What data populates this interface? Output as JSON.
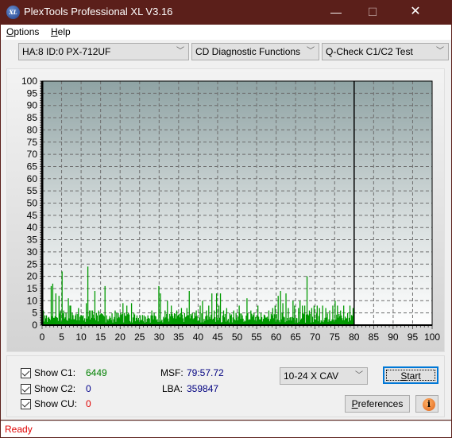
{
  "window": {
    "title": "PlexTools Professional XL V3.16",
    "icon_label": "XL",
    "minimize_glyph": "—",
    "maximize_glyph": "☐",
    "close_glyph": "✕"
  },
  "menu": {
    "items": [
      {
        "label": "Options",
        "accel": "O",
        "rest": "ptions"
      },
      {
        "label": "Help",
        "accel": "H",
        "rest": "elp"
      }
    ]
  },
  "toolbar": {
    "drive_select": "HA:8 ID:0  PX-712UF",
    "function_select": "CD Diagnostic Functions",
    "test_select": "Q-Check C1/C2 Test",
    "chevron_glyph": "﹀"
  },
  "colors": {
    "c1": "#009900",
    "c2": "#0000cc",
    "cu": "#e00000",
    "titlebar": "#5b1f1a",
    "status_text": "#e00000"
  },
  "chart_data": {
    "type": "bar",
    "title": "",
    "xlabel": "",
    "ylabel": "",
    "xlim": [
      0,
      100
    ],
    "ylim": [
      0,
      100
    ],
    "xticks": [
      0,
      5,
      10,
      15,
      20,
      25,
      30,
      35,
      40,
      45,
      50,
      55,
      60,
      65,
      70,
      75,
      80,
      85,
      90,
      95,
      100
    ],
    "yticks": [
      0,
      5,
      10,
      15,
      20,
      25,
      30,
      35,
      40,
      45,
      50,
      55,
      60,
      65,
      70,
      75,
      80,
      85,
      90,
      95,
      100
    ],
    "grid": true,
    "end_marker_x": 80,
    "series": [
      {
        "name": "C1",
        "color": "#009900",
        "x_step": 0.2,
        "x_start": 0,
        "peaks": [
          [
            0.2,
            6
          ],
          [
            0.6,
            4
          ],
          [
            1.0,
            4
          ],
          [
            1.4,
            3
          ],
          [
            2.2,
            16
          ],
          [
            2.6,
            17
          ],
          [
            3.0,
            3
          ],
          [
            3.4,
            13
          ],
          [
            3.8,
            3
          ],
          [
            4.2,
            12
          ],
          [
            4.6,
            6
          ],
          [
            4.9,
            22
          ],
          [
            5.1,
            22
          ],
          [
            5.4,
            6
          ],
          [
            6.0,
            5
          ],
          [
            6.6,
            11
          ],
          [
            7.0,
            8
          ],
          [
            7.2,
            8
          ],
          [
            7.6,
            5
          ],
          [
            8.4,
            4
          ],
          [
            9.2,
            7
          ],
          [
            9.8,
            4
          ],
          [
            10.4,
            4
          ],
          [
            11.2,
            9
          ],
          [
            11.5,
            24
          ],
          [
            11.9,
            6
          ],
          [
            12.4,
            6
          ],
          [
            12.8,
            6
          ],
          [
            13.3,
            14
          ],
          [
            13.8,
            5
          ],
          [
            14.4,
            6
          ],
          [
            16.0,
            16
          ],
          [
            16.4,
            4
          ],
          [
            17.4,
            3
          ],
          [
            18.6,
            6
          ],
          [
            19.4,
            5
          ],
          [
            20.0,
            5
          ],
          [
            20.5,
            9
          ],
          [
            21.0,
            5
          ],
          [
            21.5,
            8
          ],
          [
            22.0,
            5
          ],
          [
            22.8,
            9
          ],
          [
            23.4,
            5
          ],
          [
            24.2,
            4
          ],
          [
            25.0,
            4
          ],
          [
            26.0,
            4
          ],
          [
            27.0,
            4
          ],
          [
            28.0,
            6
          ],
          [
            28.6,
            5
          ],
          [
            29.7,
            16
          ],
          [
            30.2,
            13
          ],
          [
            31.4,
            6
          ],
          [
            32.0,
            10
          ],
          [
            33.0,
            8
          ],
          [
            34.4,
            6
          ],
          [
            35.6,
            7
          ],
          [
            37.0,
            7
          ],
          [
            37.6,
            14
          ],
          [
            38.4,
            5
          ],
          [
            39.4,
            6
          ],
          [
            40.4,
            8
          ],
          [
            41.0,
            10
          ],
          [
            42.0,
            6
          ],
          [
            42.6,
            8
          ],
          [
            43.4,
            13
          ],
          [
            44.0,
            6
          ],
          [
            44.5,
            13
          ],
          [
            45.1,
            8
          ],
          [
            45.6,
            13
          ],
          [
            46.4,
            6
          ],
          [
            47.2,
            7
          ],
          [
            48.0,
            5
          ],
          [
            49.0,
            6
          ],
          [
            49.6,
            5
          ],
          [
            50.4,
            8
          ],
          [
            51.2,
            4
          ],
          [
            52.4,
            11
          ],
          [
            53.4,
            6
          ],
          [
            54.2,
            5
          ],
          [
            55.2,
            8
          ],
          [
            56.0,
            5
          ],
          [
            57.0,
            4
          ],
          [
            58.0,
            6
          ],
          [
            59.0,
            7
          ],
          [
            59.6,
            8
          ],
          [
            60.4,
            12
          ],
          [
            60.9,
            14
          ],
          [
            61.6,
            9
          ],
          [
            62.4,
            13
          ],
          [
            63.0,
            7
          ],
          [
            64.2,
            10
          ],
          [
            64.6,
            8
          ],
          [
            65.6,
            7
          ],
          [
            66.0,
            10
          ],
          [
            66.6,
            8
          ],
          [
            67.3,
            8
          ],
          [
            67.8,
            20
          ],
          [
            68.4,
            6
          ],
          [
            69.0,
            7
          ],
          [
            69.6,
            8
          ],
          [
            70.4,
            8
          ],
          [
            71.0,
            7
          ],
          [
            71.8,
            8
          ],
          [
            72.6,
            7
          ],
          [
            73.6,
            6
          ],
          [
            74.4,
            8
          ],
          [
            75.0,
            10
          ],
          [
            75.6,
            8
          ],
          [
            76.4,
            6
          ],
          [
            77.2,
            8
          ],
          [
            78.2,
            5
          ],
          [
            78.8,
            8
          ],
          [
            79.6,
            7
          ]
        ],
        "baseline_range": [
          1,
          4
        ],
        "total": 6449
      },
      {
        "name": "C2",
        "color": "#0000cc",
        "total": 0
      },
      {
        "name": "CU",
        "color": "#e00000",
        "total": 0
      }
    ]
  },
  "controls": {
    "show_c1": {
      "label": "Show C1:",
      "checked": true,
      "value": "6449"
    },
    "show_c2": {
      "label": "Show C2:",
      "checked": true,
      "value": "0"
    },
    "show_cu": {
      "label": "Show CU:",
      "checked": true,
      "value": "0"
    },
    "msf_label": "MSF:",
    "msf_value": "79:57.72",
    "lba_label": "LBA:",
    "lba_value": "359847",
    "speed_select": "10-24 X CAV",
    "start_label": "Start",
    "start_accel": "S",
    "start_rest": "tart",
    "preferences_label": "Preferences",
    "preferences_accel": "P",
    "preferences_rest": "references",
    "info_glyph": "i"
  },
  "status": {
    "text": "Ready"
  }
}
